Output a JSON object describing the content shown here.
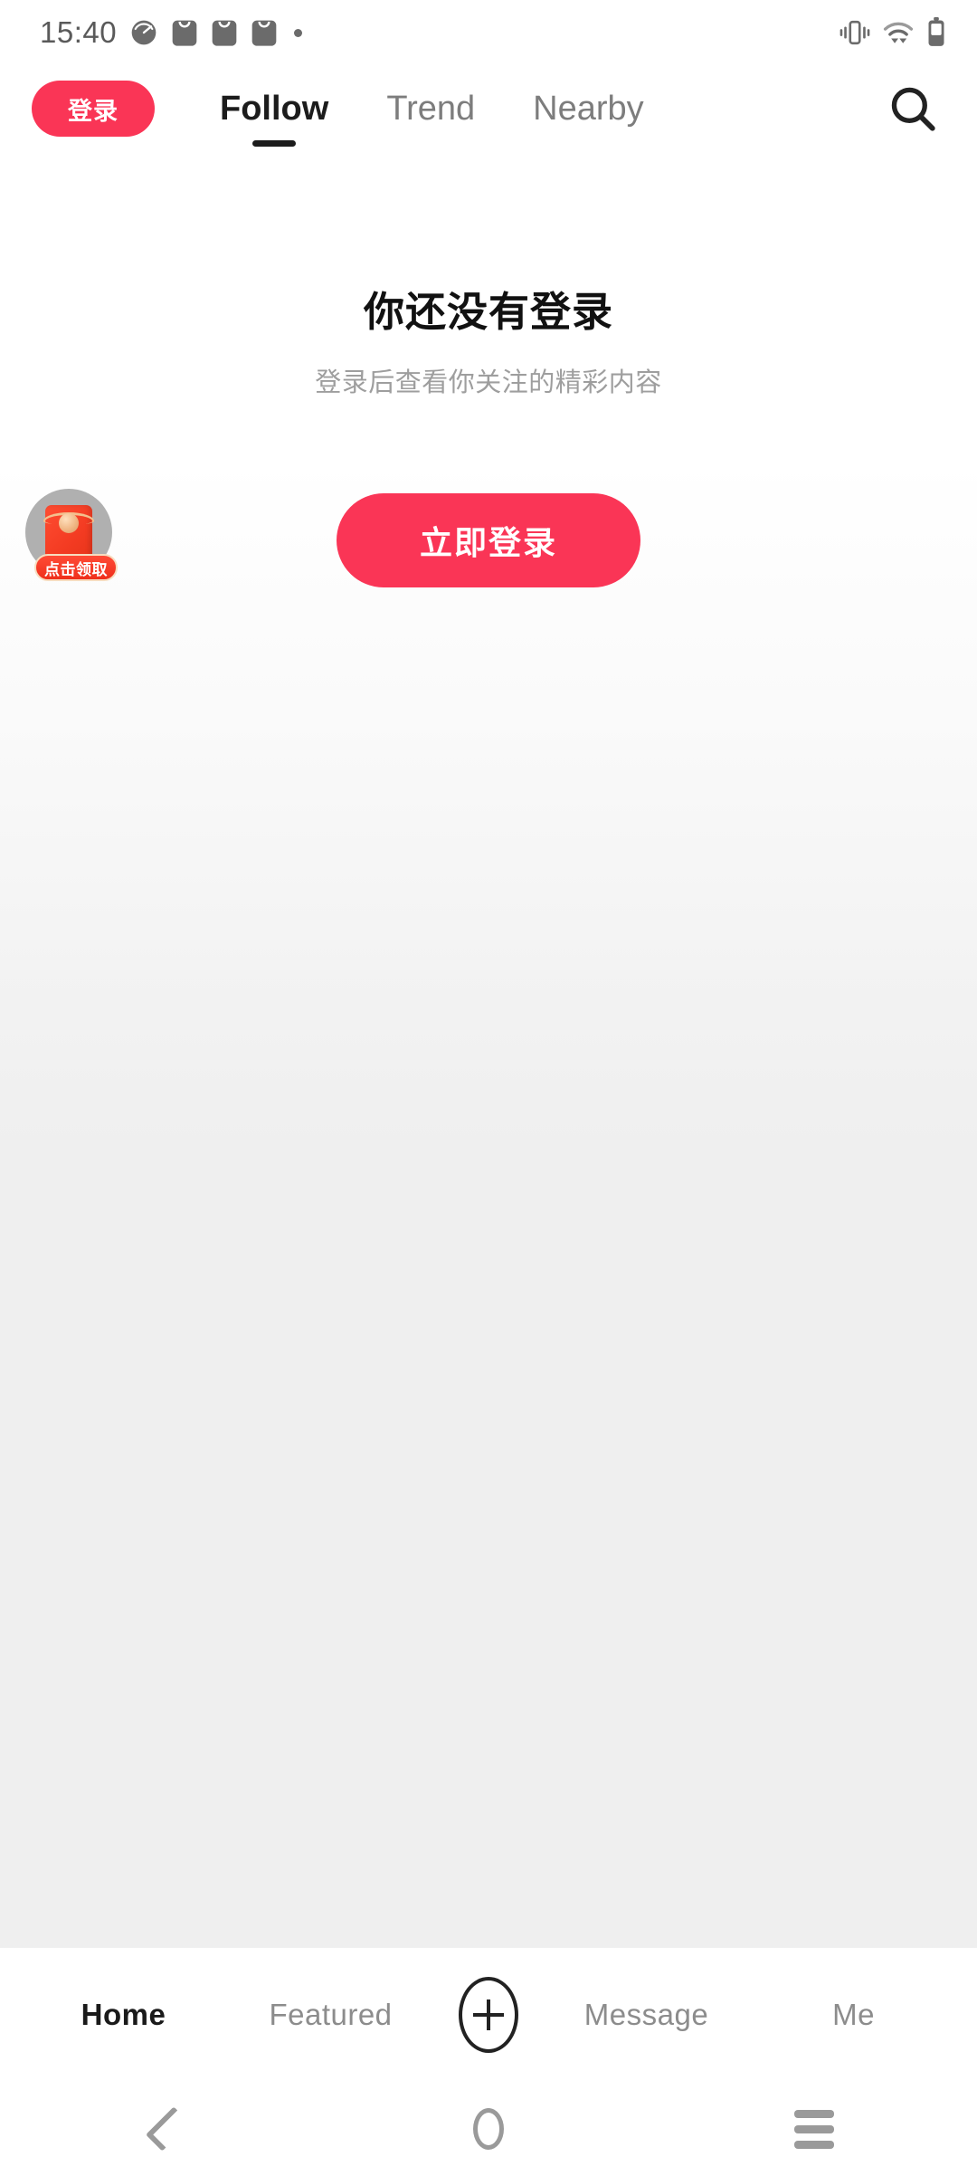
{
  "status_bar": {
    "time": "15:40",
    "left_icons": [
      "speedometer-icon",
      "shopping-bag-icon",
      "shopping-bag-icon",
      "shopping-bag-icon",
      "dot-indicator"
    ],
    "right_icons": [
      "vibrate-icon",
      "wifi-icon",
      "battery-icon"
    ]
  },
  "top_bar": {
    "login_button_label": "登录",
    "tabs": [
      {
        "label": "Follow",
        "active": true
      },
      {
        "label": "Trend",
        "active": false
      },
      {
        "label": "Nearby",
        "active": false
      }
    ],
    "search_icon": "search-icon"
  },
  "empty_state": {
    "title": "你还没有登录",
    "subtitle": "登录后查看你关注的精彩内容",
    "cta_label": "立即登录"
  },
  "floating_widget": {
    "icon": "red-envelope-icon",
    "badge_label": "点击领取"
  },
  "bottom_nav": {
    "items": [
      {
        "label": "Home",
        "active": true
      },
      {
        "label": "Featured",
        "active": false
      },
      {
        "label": "Message",
        "active": false
      },
      {
        "label": "Me",
        "active": false
      }
    ],
    "compose_icon": "plus-circle-icon"
  },
  "system_nav": {
    "back": "back-chevron-icon",
    "home": "home-circle-icon",
    "recents": "recents-menu-icon"
  },
  "colors": {
    "accent": "#fa3556",
    "accent_deep": "#f8234c",
    "text_primary": "#111111",
    "text_secondary": "#9e9e9e",
    "tab_inactive": "#7d7d7d",
    "content_bg": "#efefef"
  }
}
